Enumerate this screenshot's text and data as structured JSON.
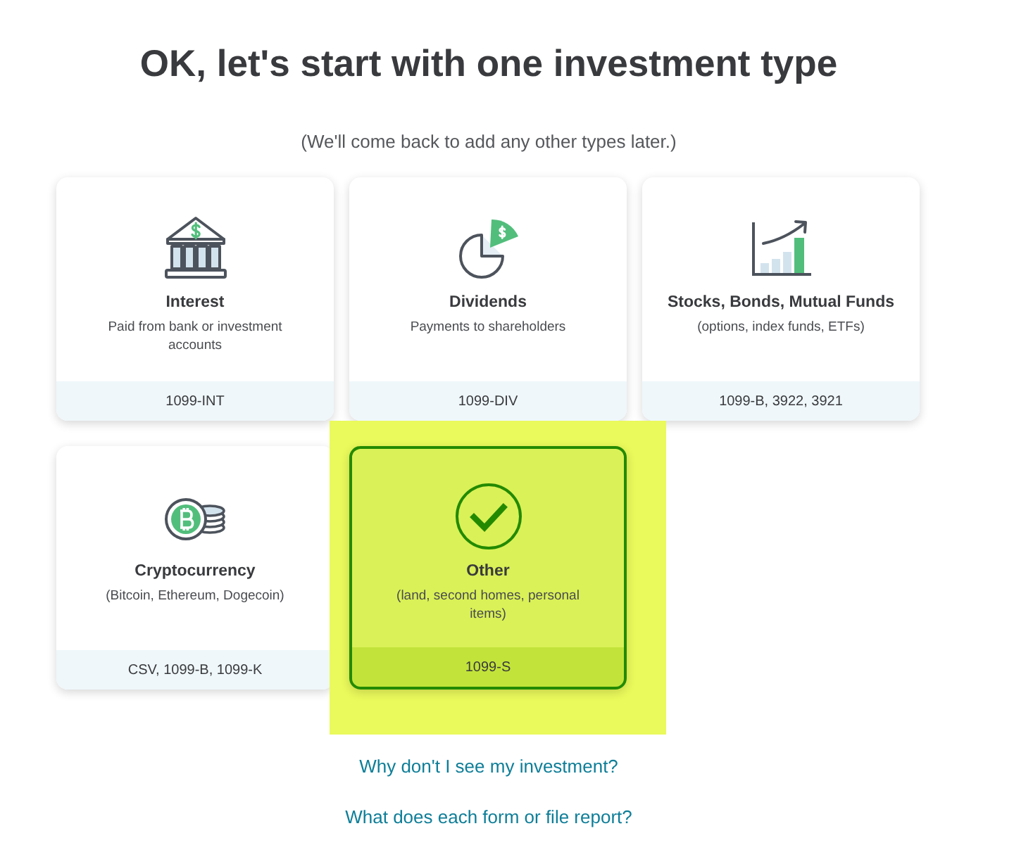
{
  "heading": {
    "title": "OK, let's start with one investment type",
    "subtitle": "(We'll come back to add any other types later.)"
  },
  "options": [
    {
      "kind": "bank",
      "title": "Interest",
      "description": "Paid from bank or investment accounts",
      "forms": "1099-INT",
      "selected": false,
      "highlighted": false
    },
    {
      "kind": "pie",
      "title": "Dividends",
      "description": "Payments to shareholders",
      "forms": "1099-DIV",
      "selected": false,
      "highlighted": false
    },
    {
      "kind": "chart",
      "title": "Stocks, Bonds, Mutual Funds",
      "description": "(options, index funds, ETFs)",
      "forms": "1099-B, 3922, 3921",
      "selected": false,
      "highlighted": false
    },
    {
      "kind": "coin",
      "title": "Cryptocurrency",
      "description": "(Bitcoin, Ethereum, Dogecoin)",
      "forms": "CSV, 1099-B, 1099-K",
      "selected": false,
      "highlighted": false
    },
    {
      "kind": "check",
      "title": "Other",
      "description": "(land, second homes, personal items)",
      "forms": "1099-S",
      "selected": true,
      "highlighted": true
    }
  ],
  "links": [
    "Why don't I see my investment?",
    "What does each form or file report?"
  ]
}
